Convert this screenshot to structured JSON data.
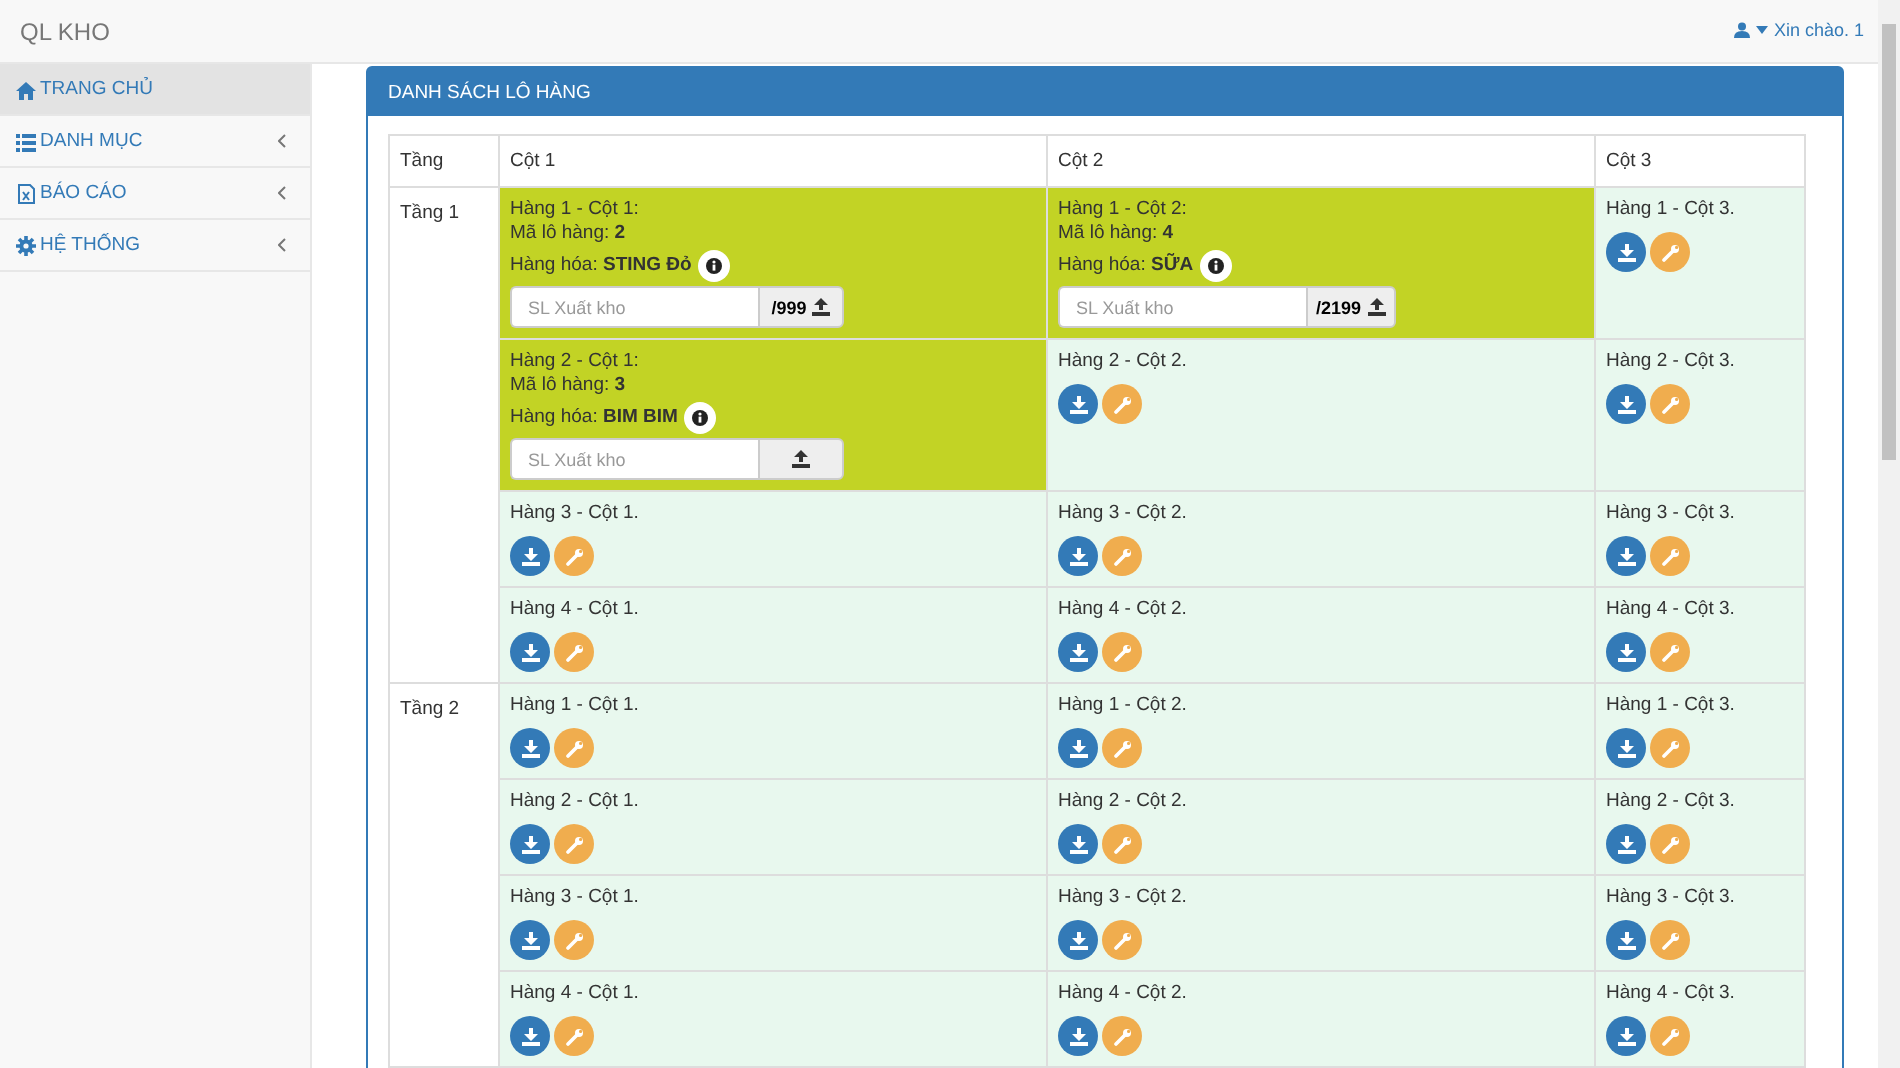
{
  "app_title": "QL KHO",
  "user_menu": {
    "label": "Xin chào. 1"
  },
  "sidebar": {
    "items": [
      {
        "label": "TRANG CHỦ",
        "selected": true,
        "has_submenu": false
      },
      {
        "label": "DANH MỤC",
        "selected": false,
        "has_submenu": true
      },
      {
        "label": "BÁO CÁO",
        "selected": false,
        "has_submenu": true
      },
      {
        "label": "HỆ THỐNG",
        "selected": false,
        "has_submenu": true
      }
    ]
  },
  "panel": {
    "title": "DANH SÁCH LÔ HÀNG",
    "table": {
      "columns": [
        "Tầng",
        "Cột 1",
        "Cột 2",
        "Cột 3"
      ],
      "floors": [
        {
          "label": "Tầng 1",
          "rows": [
            {
              "cells": [
                {
                  "kind": "lot",
                  "title": "Hàng 1 - Cột 1:",
                  "lot_code": "Mã lô hàng: **2**",
                  "goods": "Hàng hóa: **STING Đỏ**",
                  "placeholder": "SL Xuất kho",
                  "stock": "/999"
                },
                {
                  "kind": "lot",
                  "title": "Hàng 1 - Cột 2:",
                  "lot_code": "Mã lô hàng: **4**",
                  "goods": "Hàng hóa: **SỮA**",
                  "placeholder": "SL Xuất kho",
                  "stock": "/2199"
                },
                {
                  "kind": "empty",
                  "title": "Hàng 1 - Cột 3."
                }
              ]
            },
            {
              "cells": [
                {
                  "kind": "lot",
                  "title": "Hàng 2 - Cột 1:",
                  "lot_code": "Mã lô hàng: **3**",
                  "goods": "Hàng hóa: **BIM BIM**",
                  "placeholder": "SL Xuất kho"
                },
                {
                  "kind": "empty",
                  "title": "Hàng 2 - Cột 2."
                },
                {
                  "kind": "empty",
                  "title": "Hàng 2 - Cột 3."
                }
              ]
            },
            {
              "cells": [
                {
                  "kind": "empty",
                  "title": "Hàng 3 - Cột 1."
                },
                {
                  "kind": "empty",
                  "title": "Hàng 3 - Cột 2."
                },
                {
                  "kind": "empty",
                  "title": "Hàng 3 - Cột 3."
                }
              ]
            },
            {
              "cells": [
                {
                  "kind": "empty",
                  "title": "Hàng 4 - Cột 1."
                },
                {
                  "kind": "empty",
                  "title": "Hàng 4 - Cột 2."
                },
                {
                  "kind": "empty",
                  "title": "Hàng 4 - Cột 3."
                }
              ]
            }
          ]
        },
        {
          "label": "Tầng 2",
          "rows": [
            {
              "cells": [
                {
                  "kind": "empty",
                  "title": "Hàng 1 - Cột 1."
                },
                {
                  "kind": "empty",
                  "title": "Hàng 1 - Cột 2."
                },
                {
                  "kind": "empty",
                  "title": "Hàng 1 - Cột 3."
                }
              ]
            },
            {
              "cells": [
                {
                  "kind": "empty",
                  "title": "Hàng 2 - Cột 1."
                },
                {
                  "kind": "empty",
                  "title": "Hàng 2 - Cột 2."
                },
                {
                  "kind": "empty",
                  "title": "Hàng 2 - Cột 3."
                }
              ]
            },
            {
              "cells": [
                {
                  "kind": "empty",
                  "title": "Hàng 3 - Cột 1."
                },
                {
                  "kind": "empty",
                  "title": "Hàng 3 - Cột 2."
                },
                {
                  "kind": "empty",
                  "title": "Hàng 3 - Cột 3."
                }
              ]
            },
            {
              "cells": [
                {
                  "kind": "empty",
                  "title": "Hàng 4 - Cột 1."
                },
                {
                  "kind": "empty",
                  "title": "Hàng 4 - Cột 2."
                },
                {
                  "kind": "empty",
                  "title": "Hàng 4 - Cột 3."
                }
              ]
            }
          ]
        }
      ]
    }
  }
}
